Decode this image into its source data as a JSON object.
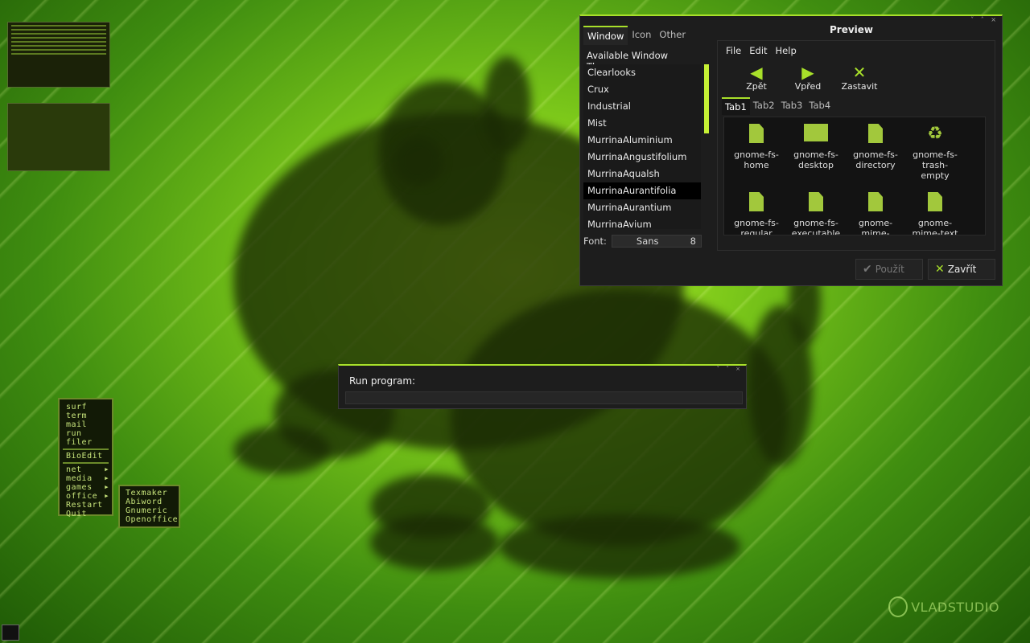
{
  "theme_window": {
    "tabs": [
      "Window",
      "Icon",
      "Other"
    ],
    "list_header": "Available Window Themes",
    "themes": [
      "Clearlooks",
      "Crux",
      "Industrial",
      "Mist",
      "MurrinaAluminium",
      "MurrinaAngustifolium",
      "MurrinaAqualsh",
      "MurrinaAurantifolia",
      "MurrinaAurantium",
      "MurrinaAvium"
    ],
    "selected_theme": "MurrinaAurantifolia",
    "font_label": "Font:",
    "font_name": "Sans",
    "font_size": "8",
    "preview_title": "Preview",
    "menus": [
      "File",
      "Edit",
      "Help"
    ],
    "tools": [
      {
        "label": "Zpět",
        "icon": "arrow-left-icon"
      },
      {
        "label": "Vpřed",
        "icon": "arrow-right-icon"
      },
      {
        "label": "Zastavit",
        "icon": "close-x-icon"
      }
    ],
    "inner_tabs": [
      "Tab1",
      "Tab2",
      "Tab3",
      "Tab4"
    ],
    "icons": [
      {
        "label": "gnome-fs-\nhome",
        "icon": "home-icon"
      },
      {
        "label": "gnome-fs-\ndesktop",
        "icon": "desktop-icon"
      },
      {
        "label": "gnome-fs-\ndirectory",
        "icon": "folder-icon"
      },
      {
        "label": "gnome-fs-\ntrash-\nempty",
        "icon": "trash-icon"
      },
      {
        "label": "gnome-fs-\nregular",
        "icon": "file-icon"
      },
      {
        "label": "gnome-fs-\nexecutable",
        "icon": "executable-icon"
      },
      {
        "label": "gnome-\nmime-",
        "icon": "mime-image-icon"
      },
      {
        "label": "gnome-\nmime-text",
        "icon": "mime-text-icon"
      }
    ],
    "apply_label": "Použít",
    "close_label": "Zavřít"
  },
  "run_dialog": {
    "label": "Run program:"
  },
  "root_menu": {
    "items": [
      "surf",
      "term",
      "mail",
      "run",
      "filer"
    ],
    "item_bioedit": "BioEdit",
    "submenus": [
      "net",
      "media",
      "games",
      "office"
    ],
    "tail_items": [
      "Restart",
      "Quit"
    ]
  },
  "office_menu": {
    "items": [
      "Texmaker",
      "Abiword",
      "Gnumeric",
      "Openoffice"
    ]
  },
  "watermark": "VLADSTUDIO",
  "colors": {
    "accent": "#a8e02a",
    "window_bg": "#1d1d1d"
  }
}
